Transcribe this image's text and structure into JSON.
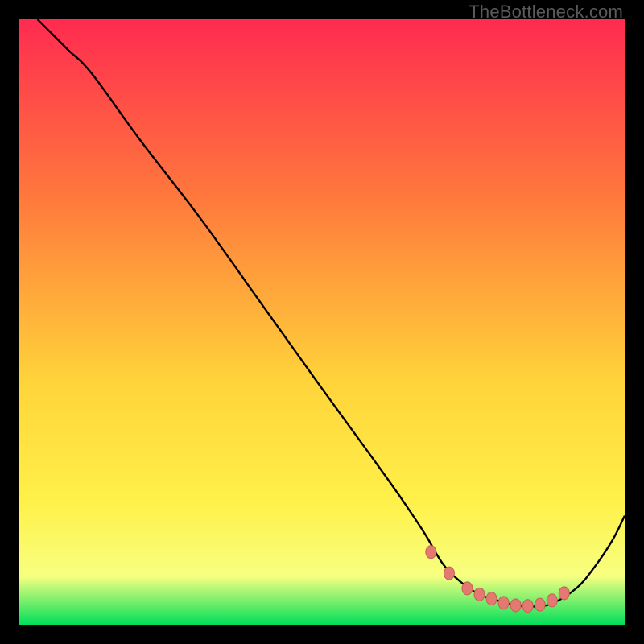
{
  "watermark": "TheBottleneck.com",
  "colors": {
    "gradient_top": "#ff2b50",
    "gradient_mid_1": "#ff7a3c",
    "gradient_mid_2": "#ffd43a",
    "gradient_mid_3": "#fff14a",
    "gradient_mid_4": "#f7ff80",
    "gradient_bottom": "#00e05a",
    "curve": "#000000",
    "marker_fill": "#e27a72",
    "marker_stroke": "#c85e56"
  },
  "chart_data": {
    "type": "line",
    "title": "",
    "xlabel": "",
    "ylabel": "",
    "xlim": [
      0,
      100
    ],
    "ylim": [
      0,
      100
    ],
    "series": [
      {
        "name": "bottleneck-curve",
        "x": [
          3,
          5,
          8,
          12,
          20,
          30,
          40,
          50,
          58,
          63,
          67,
          70,
          73,
          76,
          79,
          82,
          85,
          88,
          92,
          95,
          98,
          100
        ],
        "values": [
          100,
          98,
          95,
          91,
          80,
          67,
          53,
          39,
          28,
          21,
          15,
          10,
          7,
          5,
          4,
          3.2,
          3,
          3.5,
          6,
          9.5,
          14,
          18
        ]
      }
    ],
    "markers": {
      "name": "optimal-range",
      "x": [
        68,
        71,
        74,
        76,
        78,
        80,
        82,
        84,
        86,
        88,
        90
      ],
      "values": [
        12,
        8.5,
        6,
        5,
        4.3,
        3.6,
        3.2,
        3.1,
        3.3,
        4,
        5.2
      ]
    }
  }
}
